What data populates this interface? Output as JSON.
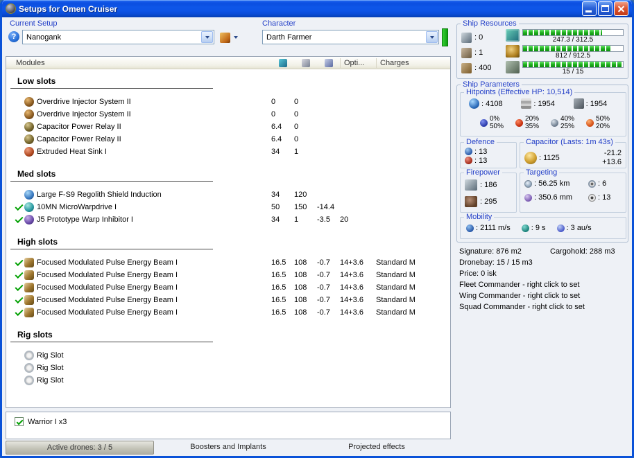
{
  "window": {
    "title": "Setups for Omen Cruiser"
  },
  "topbar": {
    "current_setup": {
      "label": "Current Setup",
      "help": "?",
      "value": "Nanogank"
    },
    "character": {
      "label": "Character",
      "value": "Darth Farmer"
    }
  },
  "modules": {
    "title": "Modules",
    "header": {
      "opti": "Opti...",
      "charges": "Charges"
    },
    "sections": [
      {
        "title": "Low slots",
        "rows": [
          {
            "icon": "overdrive",
            "name": "Overdrive Injector System II",
            "c1": "0",
            "c2": "0"
          },
          {
            "icon": "overdrive",
            "name": "Overdrive Injector System II",
            "c1": "0",
            "c2": "0"
          },
          {
            "icon": "cap-relay",
            "name": "Capacitor Power Relay II",
            "c1": "6.4",
            "c2": "0"
          },
          {
            "icon": "cap-relay",
            "name": "Capacitor Power Relay II",
            "c1": "6.4",
            "c2": "0"
          },
          {
            "icon": "heat-sink",
            "name": "Extruded Heat Sink I",
            "c1": "34",
            "c2": "1"
          }
        ]
      },
      {
        "title": "Med slots",
        "rows": [
          {
            "icon": "shield-extender",
            "name": "Large F-S9 Regolith Shield Induction",
            "c1": "34",
            "c2": "120"
          },
          {
            "active": true,
            "icon": "mwd",
            "name": "10MN MicroWarpdrive I",
            "c1": "50",
            "c2": "150",
            "c3": "-14.4"
          },
          {
            "active": true,
            "icon": "warp-inhibitor",
            "name": "J5 Prototype Warp Inhibitor I",
            "c1": "34",
            "c2": "1",
            "c3": "-3.5",
            "c4": "20"
          }
        ]
      },
      {
        "title": "High slots",
        "rows": [
          {
            "active": true,
            "icon": "laser",
            "name": "Focused Modulated Pulse Energy Beam I",
            "c1": "16.5",
            "c2": "108",
            "c3": "-0.7",
            "c4": "14+3.6",
            "charge": "Standard M"
          },
          {
            "active": true,
            "icon": "laser",
            "name": "Focused Modulated Pulse Energy Beam I",
            "c1": "16.5",
            "c2": "108",
            "c3": "-0.7",
            "c4": "14+3.6",
            "charge": "Standard M"
          },
          {
            "active": true,
            "icon": "laser",
            "name": "Focused Modulated Pulse Energy Beam I",
            "c1": "16.5",
            "c2": "108",
            "c3": "-0.7",
            "c4": "14+3.6",
            "charge": "Standard M"
          },
          {
            "active": true,
            "icon": "laser",
            "name": "Focused Modulated Pulse Energy Beam I",
            "c1": "16.5",
            "c2": "108",
            "c3": "-0.7",
            "c4": "14+3.6",
            "charge": "Standard M"
          },
          {
            "active": true,
            "icon": "laser",
            "name": "Focused Modulated Pulse Energy Beam I",
            "c1": "16.5",
            "c2": "108",
            "c3": "-0.7",
            "c4": "14+3.6",
            "charge": "Standard M"
          }
        ]
      },
      {
        "title": "Rig slots",
        "rows": [
          {
            "icon": "rig",
            "name": "Rig Slot"
          },
          {
            "icon": "rig",
            "name": "Rig Slot"
          },
          {
            "icon": "rig",
            "name": "Rig Slot"
          }
        ]
      }
    ]
  },
  "drones": {
    "items": [
      {
        "checked": true,
        "label": "Warrior I x3"
      }
    ]
  },
  "bottom_tabs": {
    "active_drones": "Active drones: 3 / 5",
    "boosters": "Boosters and Implants",
    "projected": "Projected effects"
  },
  "ship_resources": {
    "title": "Ship Resources",
    "hardpoints": [
      {
        "icon": "turret-hardpoint-icon",
        "value": ": 0"
      },
      {
        "icon": "launcher-hardpoint-icon",
        "value": ": 1"
      },
      {
        "icon": "cargo-icon",
        "value": ": 400"
      }
    ],
    "bars": [
      {
        "icon": "cpu-icon",
        "value": "247.3 / 312.5",
        "pct": 79
      },
      {
        "icon": "powergrid-icon",
        "value": "812 / 912.5",
        "pct": 89
      },
      {
        "icon": "calibration-icon",
        "value": "15 / 15",
        "pct": 100
      }
    ]
  },
  "ship_parameters": {
    "title": "Ship Parameters",
    "hitpoints": {
      "title": "Hitpoints (Effective HP: 10,514)",
      "shield": ": 4108",
      "armor": ": 1954",
      "hull": ": 1954",
      "resists": [
        {
          "shield": "0%",
          "armor": "50%"
        },
        {
          "shield": "20%",
          "armor": "35%"
        },
        {
          "shield": "40%",
          "armor": "25%"
        },
        {
          "shield": "50%",
          "armor": "20%"
        }
      ]
    },
    "defence": {
      "title": "Defence",
      "shield_recharge": ": 13",
      "armor_repair": ": 13"
    },
    "capacitor": {
      "title": "Capacitor (Lasts: 1m 43s)",
      "amount": ": 1125",
      "drain": "-21.2",
      "recharge": "+13.6"
    },
    "firepower": {
      "title": "Firepower",
      "dps": ": 186",
      "volley": ": 295"
    },
    "targeting": {
      "title": "Targeting",
      "range": ": 56.25 km",
      "max_targets": ": 6",
      "scan_res": ": 350.6 mm",
      "sensor_strength": ": 13"
    },
    "mobility": {
      "title": "Mobility",
      "speed": ": 2111 m/s",
      "align": ": 9 s",
      "warp": ": 3 au/s"
    }
  },
  "ship_info": {
    "signature": "Signature: 876 m2",
    "cargohold": "Cargohold: 288 m3",
    "dronebay": "Dronebay: 15 / 15 m3",
    "price": "Price: 0 isk",
    "fleet": "Fleet Commander - right click to set",
    "wing": "Wing Commander - right click to set",
    "squad": "Squad Commander - right click to set"
  },
  "colors": {
    "accent_blue": "#2440c8",
    "bar_green": "#1faf1f",
    "check_green": "#00a000"
  }
}
